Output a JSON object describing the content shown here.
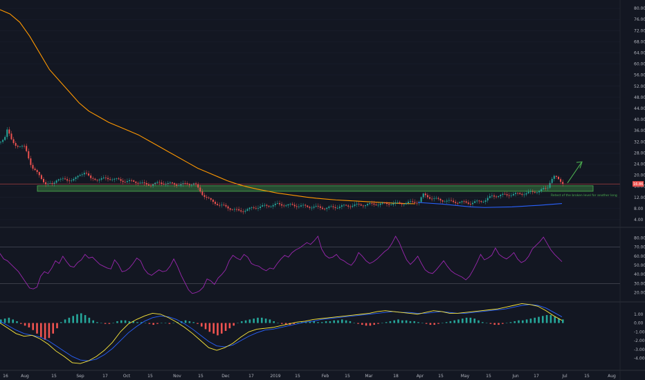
{
  "chart_data": [
    {
      "pane": "price",
      "type": "candlestick",
      "y_ticks": [
        "80.00",
        "76.00",
        "72.00",
        "68.00",
        "64.00",
        "60.00",
        "56.00",
        "52.00",
        "48.00",
        "44.00",
        "40.00",
        "36.00",
        "32.00",
        "28.00",
        "24.00",
        "20.00",
        "16.00",
        "12.00",
        "8.00",
        "4.00"
      ],
      "ylim": [
        2,
        82
      ],
      "x_ticks": [
        "16",
        "Aug",
        "15",
        "Sep",
        "17",
        "Oct",
        "15",
        "Nov",
        "15",
        "Dec",
        "17",
        "2019",
        "15",
        "Feb",
        "15",
        "Mar",
        "18",
        "Apr",
        "15",
        "May",
        "15",
        "Jun",
        "17",
        "Jul",
        "15",
        "Aug"
      ],
      "last_price_label": "16.86",
      "last_price": 16.86,
      "support_zone": [
        14.2,
        16.2
      ],
      "annotation": "Retest of the broken level for another long",
      "moving_average": {
        "name": "MA",
        "color": "#ff9800",
        "values": [
          [
            0,
            79.5
          ],
          [
            1,
            78
          ],
          [
            2,
            75
          ],
          [
            3,
            70
          ],
          [
            4,
            64
          ],
          [
            5,
            58
          ],
          [
            6,
            54
          ],
          [
            7,
            50
          ],
          [
            8,
            46
          ],
          [
            9,
            43
          ],
          [
            10,
            41
          ],
          [
            11,
            39
          ],
          [
            12,
            37.5
          ],
          [
            13,
            36
          ],
          [
            14,
            34.5
          ],
          [
            15,
            32.5
          ],
          [
            16,
            30.5
          ],
          [
            17,
            28.5
          ],
          [
            18,
            26.5
          ],
          [
            19,
            24.5
          ],
          [
            20,
            22.5
          ],
          [
            21,
            21
          ],
          [
            22,
            19.5
          ],
          [
            23,
            18
          ],
          [
            24,
            16.8
          ],
          [
            25,
            15.8
          ],
          [
            26,
            15
          ],
          [
            27,
            14.3
          ],
          [
            28,
            13.6
          ],
          [
            29,
            13.1
          ],
          [
            30,
            12.6
          ],
          [
            31,
            12.1
          ],
          [
            32,
            11.7
          ],
          [
            33,
            11.4
          ],
          [
            34,
            11.1
          ],
          [
            35,
            10.9
          ],
          [
            36,
            10.7
          ],
          [
            37,
            10.5
          ],
          [
            38,
            10.3
          ],
          [
            39,
            10.1
          ],
          [
            40,
            9.9
          ],
          [
            41,
            9.8
          ],
          [
            42,
            9.7
          ]
        ]
      },
      "colors": {
        "up": "#26a69a",
        "down": "#ef5350",
        "support": "#4caf50",
        "trend": "#2962ff",
        "arrow": "#4caf50"
      }
    },
    {
      "pane": "rsi",
      "type": "line",
      "y_ticks": [
        "80.00",
        "70.00",
        "60.00",
        "50.00",
        "40.00",
        "30.00",
        "20.00"
      ],
      "ylim": [
        12,
        88
      ],
      "levels": [
        70,
        30
      ],
      "series": [
        {
          "color": "#9c27b0",
          "values": [
            63,
            57,
            55,
            51,
            47,
            43,
            37,
            31,
            25,
            24,
            26,
            38,
            43,
            41,
            47,
            55,
            52,
            60,
            54,
            49,
            48,
            53,
            56,
            62,
            58,
            59,
            55,
            51,
            49,
            47,
            46,
            56,
            51,
            43,
            44,
            47,
            52,
            58,
            55,
            46,
            41,
            39,
            42,
            45,
            43,
            44,
            49,
            57,
            49,
            39,
            31,
            23,
            19,
            20,
            22,
            26,
            35,
            33,
            29,
            36,
            40,
            45,
            55,
            61,
            58,
            56,
            62,
            59,
            52,
            50,
            49,
            46,
            44,
            47,
            46,
            52,
            57,
            61,
            59,
            64,
            67,
            69,
            72,
            75,
            73,
            77,
            82,
            68,
            61,
            58,
            59,
            62,
            57,
            55,
            52,
            50,
            55,
            64,
            60,
            55,
            52,
            54,
            57,
            61,
            65,
            68,
            74,
            82,
            75,
            65,
            56,
            51,
            55,
            60,
            52,
            45,
            42,
            41,
            45,
            50,
            55,
            49,
            44,
            41,
            39,
            37,
            34,
            38,
            45,
            53,
            62,
            56,
            58,
            61,
            69,
            62,
            59,
            57,
            60,
            64,
            57,
            53,
            55,
            60,
            68,
            72,
            76,
            81,
            74,
            67,
            62,
            58,
            54
          ]
        }
      ]
    },
    {
      "pane": "macd",
      "type": "histogram+line",
      "y_ticks": [
        "1.00",
        "0.00",
        "-1.00",
        "-2.00",
        "-3.00",
        "-4.00"
      ],
      "ylim": [
        -4.9,
        2.0
      ],
      "colors": {
        "macd": "#ffeb3b",
        "signal": "#2962ff",
        "hist_up": "#26a69a",
        "hist_down": "#ef5350"
      },
      "histogram": [
        0.4,
        0.5,
        0.6,
        0.4,
        0.2,
        -0.1,
        -0.3,
        -0.5,
        -0.8,
        -1.2,
        -1.6,
        -1.9,
        -1.7,
        -1.2,
        -0.6,
        0.1,
        0.4,
        0.6,
        0.8,
        1.0,
        1.1,
        0.9,
        0.6,
        0.3,
        0.1,
        0.0,
        -0.1,
        -0.1,
        0.0,
        0.2,
        0.3,
        0.3,
        0.2,
        0.2,
        0.1,
        0.1,
        0.0,
        -0.1,
        -0.2,
        -0.1,
        0.0,
        0.0,
        -0.1,
        0.0,
        0.1,
        0.2,
        0.3,
        0.2,
        0.1,
        -0.1,
        -0.4,
        -0.7,
        -1.0,
        -1.2,
        -1.4,
        -1.2,
        -0.9,
        -0.6,
        -0.3,
        0.0,
        0.2,
        0.3,
        0.4,
        0.5,
        0.6,
        0.6,
        0.5,
        0.4,
        0.2,
        0.0,
        -0.1,
        -0.2,
        -0.2,
        -0.1,
        0.0,
        0.1,
        0.1,
        0.2,
        0.2,
        0.1,
        0.1,
        0.2,
        0.2,
        0.3,
        0.3,
        0.4,
        0.3,
        0.2,
        0.0,
        -0.1,
        -0.2,
        -0.3,
        -0.3,
        -0.2,
        -0.1,
        0.0,
        0.1,
        0.2,
        0.3,
        0.4,
        0.3,
        0.3,
        0.2,
        0.2,
        0.1,
        0.0,
        -0.1,
        -0.2,
        -0.2,
        -0.1,
        0.0,
        0.1,
        0.2,
        0.3,
        0.4,
        0.5,
        0.6,
        0.6,
        0.5,
        0.3,
        0.1,
        0.0,
        -0.1,
        -0.2,
        -0.2,
        -0.1,
        0.0,
        0.1,
        0.2,
        0.3,
        0.3,
        0.4,
        0.5,
        0.6,
        0.7,
        0.8,
        0.9,
        0.9,
        0.7,
        0.5,
        0.4
      ],
      "macd": [
        0.0,
        -0.6,
        -1.2,
        -1.5,
        -1.4,
        -1.8,
        -2.4,
        -3.2,
        -3.8,
        -4.5,
        -4.6,
        -4.3,
        -3.8,
        -3.1,
        -2.2,
        -1.0,
        -0.1,
        0.4,
        0.8,
        1.1,
        1.0,
        0.6,
        0.1,
        -0.5,
        -1.2,
        -2.0,
        -2.8,
        -3.1,
        -2.8,
        -2.3,
        -1.6,
        -1.0,
        -0.7,
        -0.6,
        -0.5,
        -0.3,
        -0.1,
        0.1,
        0.2,
        0.4,
        0.5,
        0.6,
        0.7,
        0.8,
        0.9,
        1.0,
        1.1,
        1.3,
        1.4,
        1.3,
        1.2,
        1.1,
        1.0,
        1.2,
        1.4,
        1.3,
        1.1,
        1.1,
        1.2,
        1.3,
        1.4,
        1.5,
        1.6,
        1.8,
        2.0,
        2.2,
        2.1,
        1.9,
        1.4,
        0.8,
        0.3
      ],
      "signal": [
        0.2,
        -0.3,
        -0.8,
        -1.2,
        -1.4,
        -1.6,
        -2.0,
        -2.6,
        -3.2,
        -3.8,
        -4.2,
        -4.3,
        -4.1,
        -3.6,
        -2.9,
        -2.0,
        -1.1,
        -0.4,
        0.2,
        0.6,
        0.8,
        0.7,
        0.4,
        -0.1,
        -0.7,
        -1.4,
        -2.1,
        -2.6,
        -2.7,
        -2.5,
        -2.0,
        -1.5,
        -1.1,
        -0.8,
        -0.7,
        -0.5,
        -0.3,
        -0.1,
        0.1,
        0.2,
        0.4,
        0.5,
        0.6,
        0.7,
        0.8,
        0.9,
        1.0,
        1.1,
        1.2,
        1.3,
        1.2,
        1.2,
        1.1,
        1.1,
        1.2,
        1.3,
        1.2,
        1.1,
        1.1,
        1.2,
        1.3,
        1.4,
        1.5,
        1.6,
        1.8,
        2.0,
        2.1,
        2.0,
        1.7,
        1.2,
        0.7
      ]
    }
  ]
}
